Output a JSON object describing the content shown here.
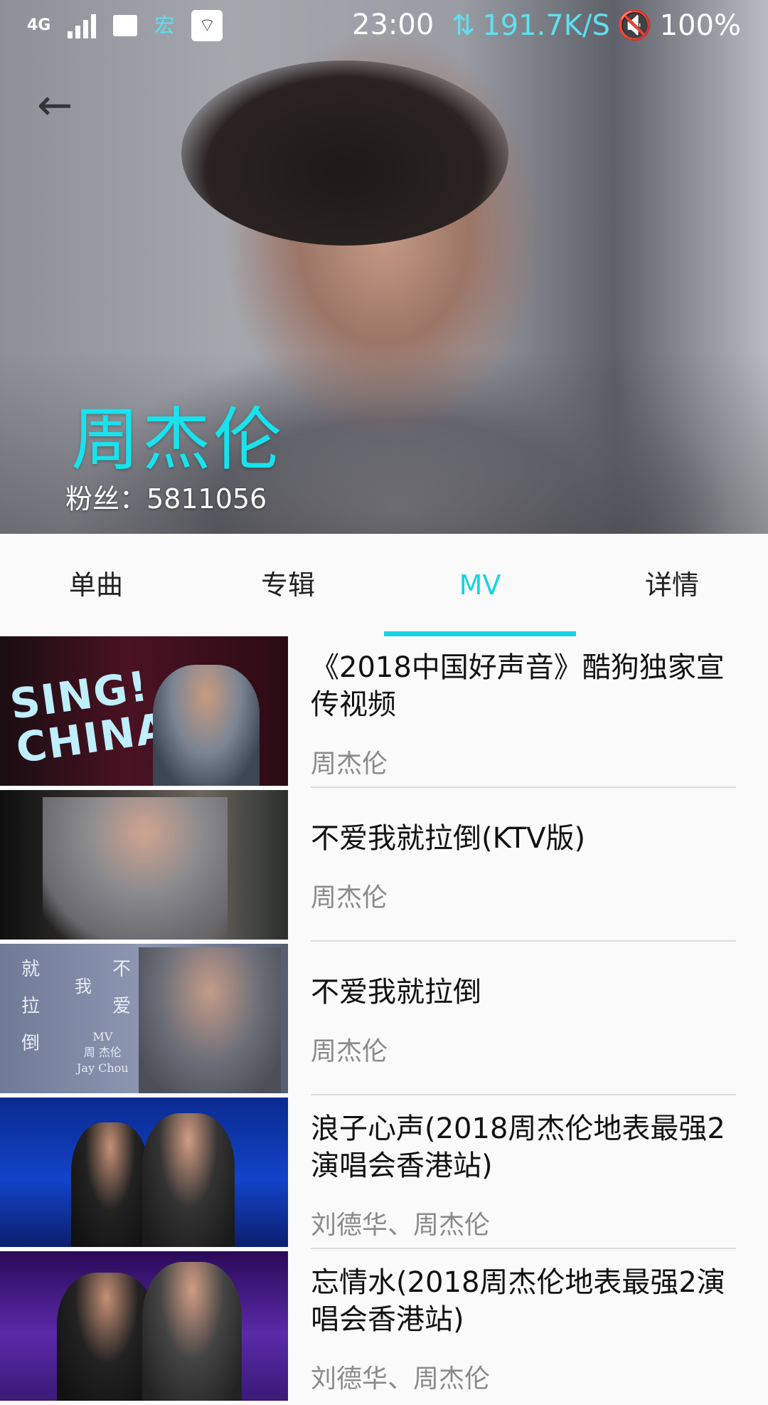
{
  "status_bar": {
    "network_type": "4G",
    "carrier_icon": "宏",
    "time": "23:00",
    "net_speed": "191.7K/S",
    "battery": "100%",
    "icons": [
      "signal-icon",
      "image-icon",
      "wifi-icon",
      "data-transfer-icon",
      "mute-icon"
    ]
  },
  "header": {
    "back_icon": "arrow-left-icon",
    "artist_name": "周杰伦",
    "fans_text": "粉丝：5811056"
  },
  "tabs": [
    {
      "label": "单曲",
      "active": false
    },
    {
      "label": "专辑",
      "active": false
    },
    {
      "label": "MV",
      "active": true
    },
    {
      "label": "详情",
      "active": false
    }
  ],
  "accent_color": "#17d3e3",
  "mv_list": [
    {
      "title": "《2018中国好声音》酷狗独家宣传视频",
      "artist": "周杰伦",
      "thumb_text": [
        "SING!",
        "CHINA"
      ]
    },
    {
      "title": "不爱我就拉倒(KTV版)",
      "artist": "周杰伦"
    },
    {
      "title": "不爱我就拉倒",
      "artist": "周杰伦",
      "thumb_text": [
        "就",
        "拉",
        "倒",
        "我",
        "不",
        "爱",
        "MV",
        "周 杰伦",
        "Jay Chou"
      ]
    },
    {
      "title": "浪子心声(2018周杰伦地表最强2演唱会香港站)",
      "artist": "刘德华、周杰伦"
    },
    {
      "title": "忘情水(2018周杰伦地表最强2演唱会香港站)",
      "artist": "刘德华、周杰伦"
    }
  ]
}
